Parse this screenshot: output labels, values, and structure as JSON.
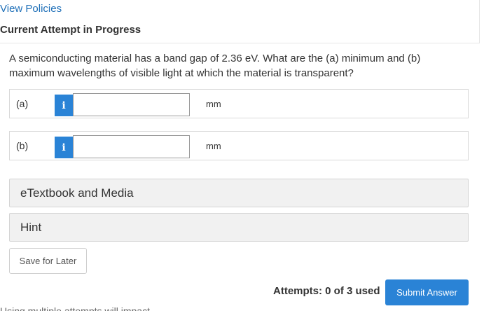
{
  "header": {
    "view_policies": "View Policies",
    "attempt_status": "Current Attempt in Progress"
  },
  "question": {
    "text": "A semiconducting material has a band gap of 2.36 eV. What are the (a) minimum and (b) maximum wavelengths of visible light at which the material is transparent?"
  },
  "answers": [
    {
      "label": "(a)",
      "info_icon": "i",
      "value": "",
      "unit": "mm"
    },
    {
      "label": "(b)",
      "info_icon": "i",
      "value": "",
      "unit": "mm"
    }
  ],
  "resources": {
    "etextbook": "eTextbook and Media",
    "hint": "Hint"
  },
  "actions": {
    "save_label": "Save for Later",
    "attempts_text": "Attempts: 0 of 3 used",
    "submit_label": "Submit Answer"
  },
  "footer": {
    "cut_text": "Using multiple attempts will impact"
  },
  "colors": {
    "accent": "#2a83d6",
    "link": "#1e6fb8"
  }
}
